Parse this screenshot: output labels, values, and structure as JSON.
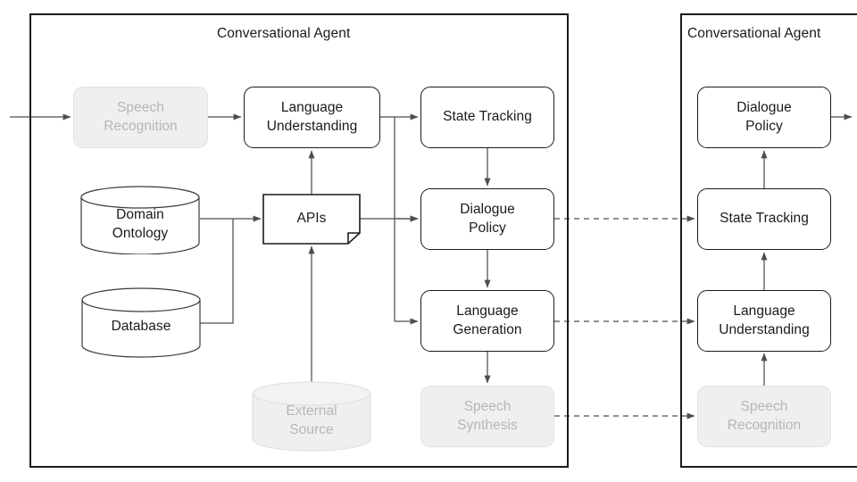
{
  "diagram": {
    "title_left": "Conversational Agent",
    "title_right": "Conversational Agent",
    "colors": {
      "stroke": "#1a1a1a",
      "muted_stroke": "#e2e2e2",
      "muted_fill": "#efefef",
      "muted_text": "#b6b6b6",
      "wire": "#4d4d4d",
      "background": "#ffffff"
    }
  },
  "left_panel": {
    "title": "Conversational Agent",
    "nodes": {
      "speech_recognition": "Speech\nRecognition",
      "language_understanding": "Language\nUnderstanding",
      "state_tracking": "State Tracking",
      "dialogue_policy": "Dialogue\nPolicy",
      "language_generation": "Language\nGeneration",
      "speech_synthesis": "Speech\nSynthesis",
      "apis": "APIs",
      "domain_ontology": "Domain\nOntology",
      "database": "Database",
      "external_source": "External\nSource"
    }
  },
  "right_panel": {
    "title": "Conversational Agent",
    "nodes": {
      "dialogue_policy": "Dialogue\nPolicy",
      "state_tracking": "State Tracking",
      "language_understanding": "Language\nUnderstanding",
      "speech_recognition": "Speech\nRecognition"
    }
  },
  "edges": [
    {
      "from": "input",
      "to": "speech_recognition",
      "style": "solid"
    },
    {
      "from": "speech_recognition",
      "to": "language_understanding",
      "style": "solid"
    },
    {
      "from": "language_understanding",
      "to": "state_tracking",
      "style": "solid"
    },
    {
      "from": "language_understanding",
      "to": "dialogue_policy",
      "style": "solid"
    },
    {
      "from": "language_understanding",
      "to": "language_generation",
      "style": "solid"
    },
    {
      "from": "state_tracking",
      "to": "dialogue_policy",
      "style": "solid"
    },
    {
      "from": "dialogue_policy",
      "to": "language_generation",
      "style": "solid"
    },
    {
      "from": "language_generation",
      "to": "speech_synthesis",
      "style": "solid"
    },
    {
      "from": "apis",
      "to": "language_understanding",
      "style": "solid"
    },
    {
      "from": "apis",
      "to": "dialogue_policy",
      "style": "solid"
    },
    {
      "from": "domain_ontology",
      "to": "apis",
      "style": "solid"
    },
    {
      "from": "database",
      "to": "apis",
      "style": "solid"
    },
    {
      "from": "external_source",
      "to": "apis",
      "style": "solid"
    },
    {
      "from": "dialogue_policy_left",
      "to": "state_tracking_right",
      "style": "dashed"
    },
    {
      "from": "language_generation_left",
      "to": "language_understanding_right",
      "style": "dashed"
    },
    {
      "from": "speech_synthesis_left",
      "to": "speech_recognition_right",
      "style": "dashed"
    },
    {
      "from": "speech_recognition_right",
      "to": "language_understanding_right",
      "style": "solid"
    },
    {
      "from": "language_understanding_right",
      "to": "state_tracking_right",
      "style": "solid"
    },
    {
      "from": "state_tracking_right",
      "to": "dialogue_policy_right",
      "style": "solid"
    },
    {
      "from": "dialogue_policy_right",
      "to": "output",
      "style": "solid"
    }
  ]
}
